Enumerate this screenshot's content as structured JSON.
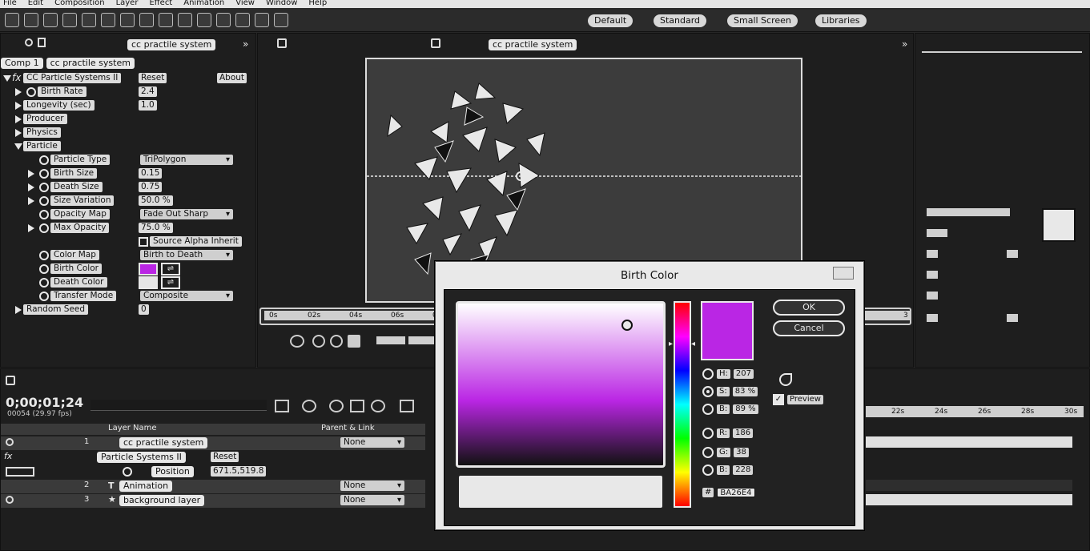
{
  "menu": [
    "File",
    "Edit",
    "Composition",
    "Layer",
    "Effect",
    "Animation",
    "View",
    "Window",
    "Help"
  ],
  "workspaces": [
    "Default",
    "Standard",
    "Small Screen",
    "Libraries"
  ],
  "effect_controls": {
    "tab": "cc practile system",
    "breadcrumb_comp": "Comp 1",
    "breadcrumb_layer": "cc practile system",
    "effect_name": "CC Particle Systems II",
    "reset": "Reset",
    "about": "About",
    "props": {
      "birth_rate": {
        "label": "Birth Rate",
        "value": "2.4"
      },
      "longevity": {
        "label": "Longevity (sec)",
        "value": "1.0"
      },
      "producer": {
        "label": "Producer"
      },
      "physics": {
        "label": "Physics"
      },
      "particle": {
        "label": "Particle"
      },
      "particle_type": {
        "label": "Particle Type",
        "value": "TriPolygon"
      },
      "birth_size": {
        "label": "Birth Size",
        "value": "0.15"
      },
      "death_size": {
        "label": "Death Size",
        "value": "0.75"
      },
      "size_variation": {
        "label": "Size Variation",
        "value": "50.0 %"
      },
      "opacity_map": {
        "label": "Opacity Map",
        "value": "Fade Out Sharp"
      },
      "max_opacity": {
        "label": "Max Opacity",
        "value": "75.0 %"
      },
      "source_alpha": {
        "label": "Source Alpha Inherit"
      },
      "color_map": {
        "label": "Color Map",
        "value": "Birth to Death"
      },
      "birth_color": {
        "label": "Birth Color"
      },
      "death_color": {
        "label": "Death Color"
      },
      "transfer_mode": {
        "label": "Transfer Mode",
        "value": "Composite"
      },
      "random_seed": {
        "label": "Random Seed",
        "value": "0"
      }
    }
  },
  "composition": {
    "tab": "cc practile system",
    "ruler_ticks": [
      "0s",
      "02s",
      "04s",
      "06s",
      "08s"
    ],
    "ruler_end": "3"
  },
  "timeline": {
    "timecode": "0;00;01;24",
    "fps": "00054 (29.97 fps)",
    "col_layer_name": "Layer Name",
    "col_parent": "Parent & Link",
    "layers": [
      {
        "num": "1",
        "name": "cc practile system",
        "parent": "None"
      },
      {
        "num": "2",
        "name": "Animation",
        "parent": "None"
      },
      {
        "num": "3",
        "name": "background layer",
        "parent": "None"
      }
    ],
    "fx_name": "Particle Systems II",
    "reset": "Reset",
    "position_label": "Position",
    "position_value": "671.5,519.8",
    "ruler_ticks": [
      "22s",
      "24s",
      "26s",
      "28s",
      "30s"
    ]
  },
  "dialog": {
    "title": "Birth Color",
    "ok": "OK",
    "cancel": "Cancel",
    "preview": "Preview",
    "hsb": [
      {
        "label": "H:",
        "value": "207"
      },
      {
        "label": "S:",
        "value": "83 %"
      },
      {
        "label": "B:",
        "value": "89 %"
      }
    ],
    "rgb": [
      {
        "label": "R:",
        "value": "186"
      },
      {
        "label": "G:",
        "value": "38"
      },
      {
        "label": "B:",
        "value": "228"
      }
    ],
    "hex_label": "#",
    "hex": "BA26E4",
    "colors": {
      "new": "#BA26E4",
      "old": "#BA26E4"
    }
  }
}
